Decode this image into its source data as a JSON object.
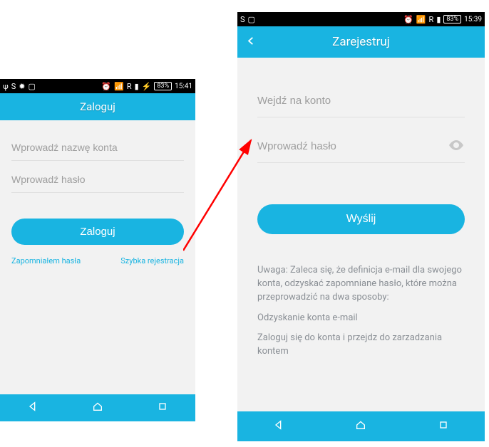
{
  "left": {
    "statusbar": {
      "left_icons": [
        "ψ",
        "S",
        "✹",
        "▢"
      ],
      "right_icons": [
        "⏰",
        "📶",
        "R",
        "📶",
        "⚡"
      ],
      "battery": "83%",
      "time": "15:41"
    },
    "title": "Zaloguj",
    "account_placeholder": "Wprowadź nazwę konta",
    "password_placeholder": "Wprowadź hasło",
    "login_button": "Zaloguj",
    "forgot_link": "Zapomniałem hasła",
    "register_link": "Szybka rejestracja"
  },
  "right": {
    "statusbar": {
      "left_icons": [
        "S",
        "▢"
      ],
      "right_icons": [
        "⏰",
        "📶",
        "R",
        "📶"
      ],
      "battery": "83%",
      "time": "15:39"
    },
    "title": "Zarejestruj",
    "account_placeholder": "Wejdź na konto",
    "password_placeholder": "Wprowadź hasło",
    "submit_button": "Wyślij",
    "note_intro": "Uwaga: Zaleca się, że definicja e-mail dla swojego konta, odzyskać zapomniane hasło, które można przeprowadzić na dwa sposoby:",
    "note_line1": "Odzyskanie konta e-mail",
    "note_line2": "Zaloguj się do konta i przejdz do zarzadzania kontem"
  },
  "colors": {
    "accent": "#19b4e1",
    "arrow": "#ff0000"
  }
}
